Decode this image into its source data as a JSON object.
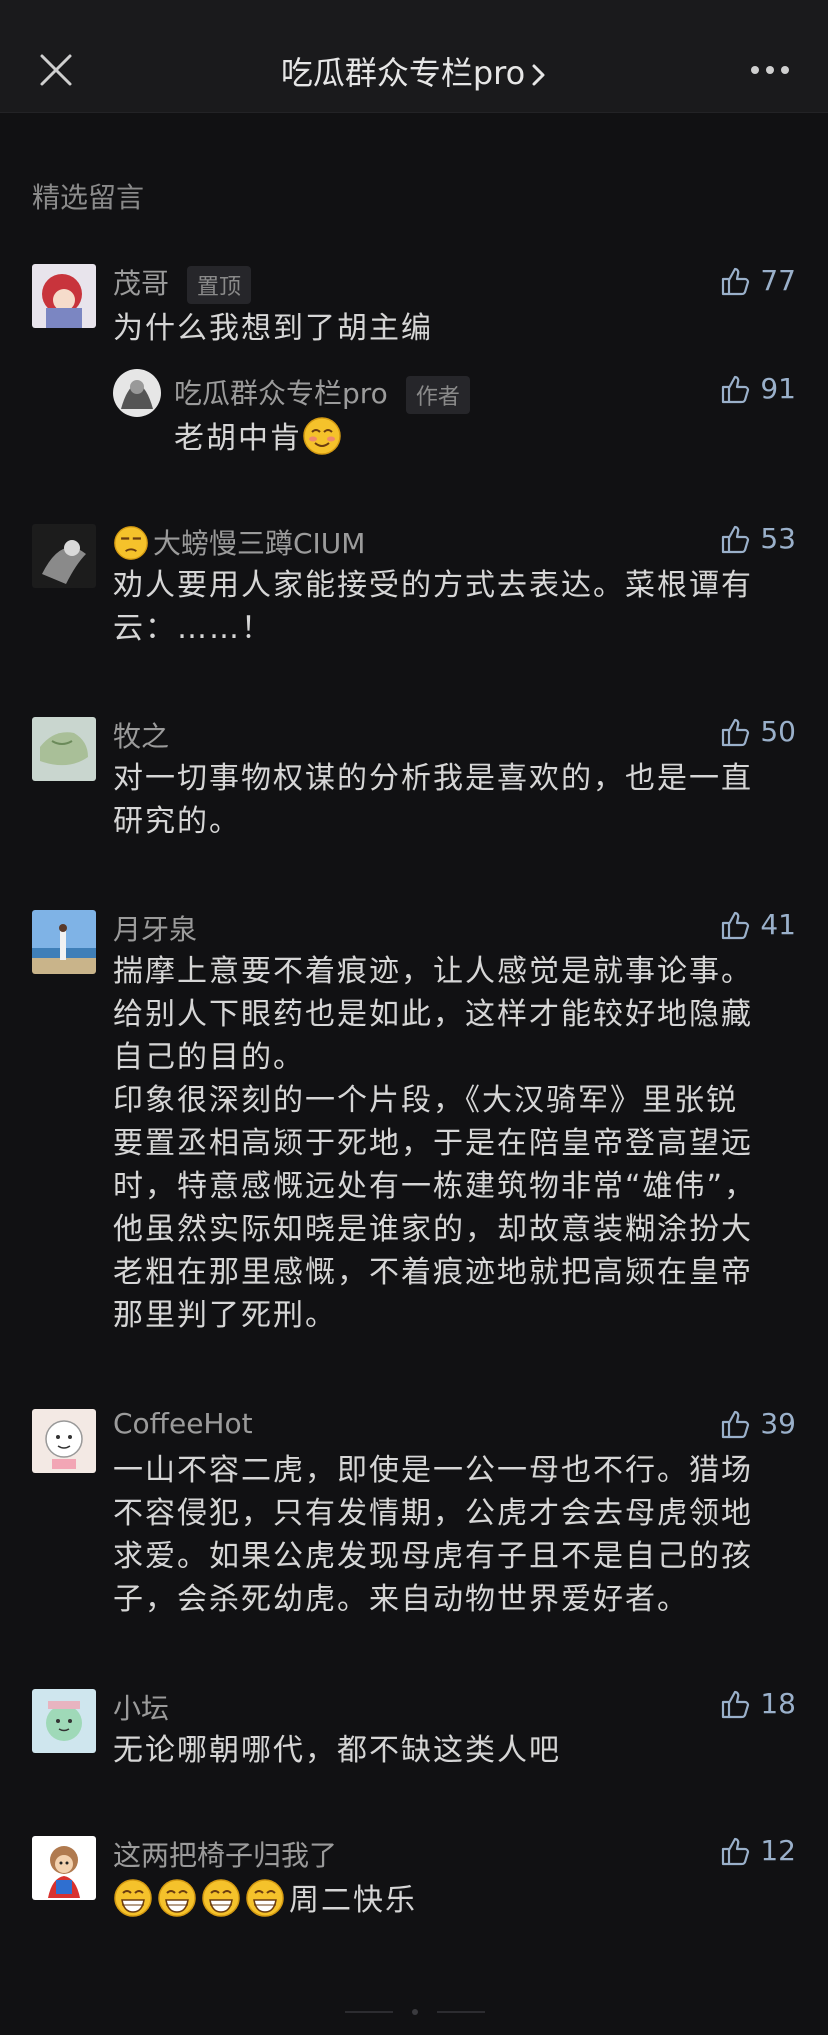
{
  "header": {
    "title": "吃瓜群众专栏pro",
    "close_icon": "close-icon",
    "more_icon": "more-dots-icon"
  },
  "section_title": "精选留言",
  "colors": {
    "bg": "#111113",
    "like": "#9ab0ca",
    "text": "#d6d6d6"
  },
  "comments": [
    {
      "name": "茂哥",
      "tag": "置顶",
      "likes": "77",
      "text": "为什么我想到了胡主编",
      "reply": {
        "name": "吃瓜群众专栏pro",
        "tag": "作者",
        "likes": "91",
        "text": "老胡中肯",
        "emoji": "smiling-blush-emoji"
      }
    },
    {
      "name": "大螃慢三蹲CIUM",
      "name_emoji": "unamused-face-emoji",
      "likes": "53",
      "lines": [
        "劝人要用人家能接受的方式去表达。菜根谭有",
        "云：……！"
      ]
    },
    {
      "name": "牧之",
      "likes": "50",
      "lines": [
        "对一切事物权谋的分析我是喜欢的，也是一直",
        "研究的。"
      ]
    },
    {
      "name": "月牙泉",
      "likes": "41",
      "lines": [
        "揣摩上意要不着痕迹，让人感觉是就事论事。",
        "给别人下眼药也是如此，这样才能较好地隐藏",
        "自己的目的。",
        "印象很深刻的一个片段，《大汉骑军》里张锐",
        "要置丞相高颎于死地，于是在陪皇帝登高望远",
        "时，特意感慨远处有一栋建筑物非常“雄伟”，",
        "他虽然实际知晓是谁家的，却故意装糊涂扮大",
        "老粗在那里感慨，不着痕迹地就把高颎在皇帝",
        "那里判了死刑。"
      ]
    },
    {
      "name": "CoffeeHot",
      "likes": "39",
      "lines": [
        "一山不容二虎，即使是一公一母也不行。猎场",
        "不容侵犯，只有发情期，公虎才会去母虎领地",
        "求爱。如果公虎发现母虎有子且不是自己的孩",
        "子，会杀死幼虎。来自动物世界爱好者。"
      ]
    },
    {
      "name": "小坛",
      "likes": "18",
      "lines": [
        "无论哪朝哪代，都不缺这类人吧"
      ]
    },
    {
      "name": "这两把椅子归我了",
      "likes": "12",
      "text": "周二快乐",
      "emoji_count": "4"
    }
  ]
}
